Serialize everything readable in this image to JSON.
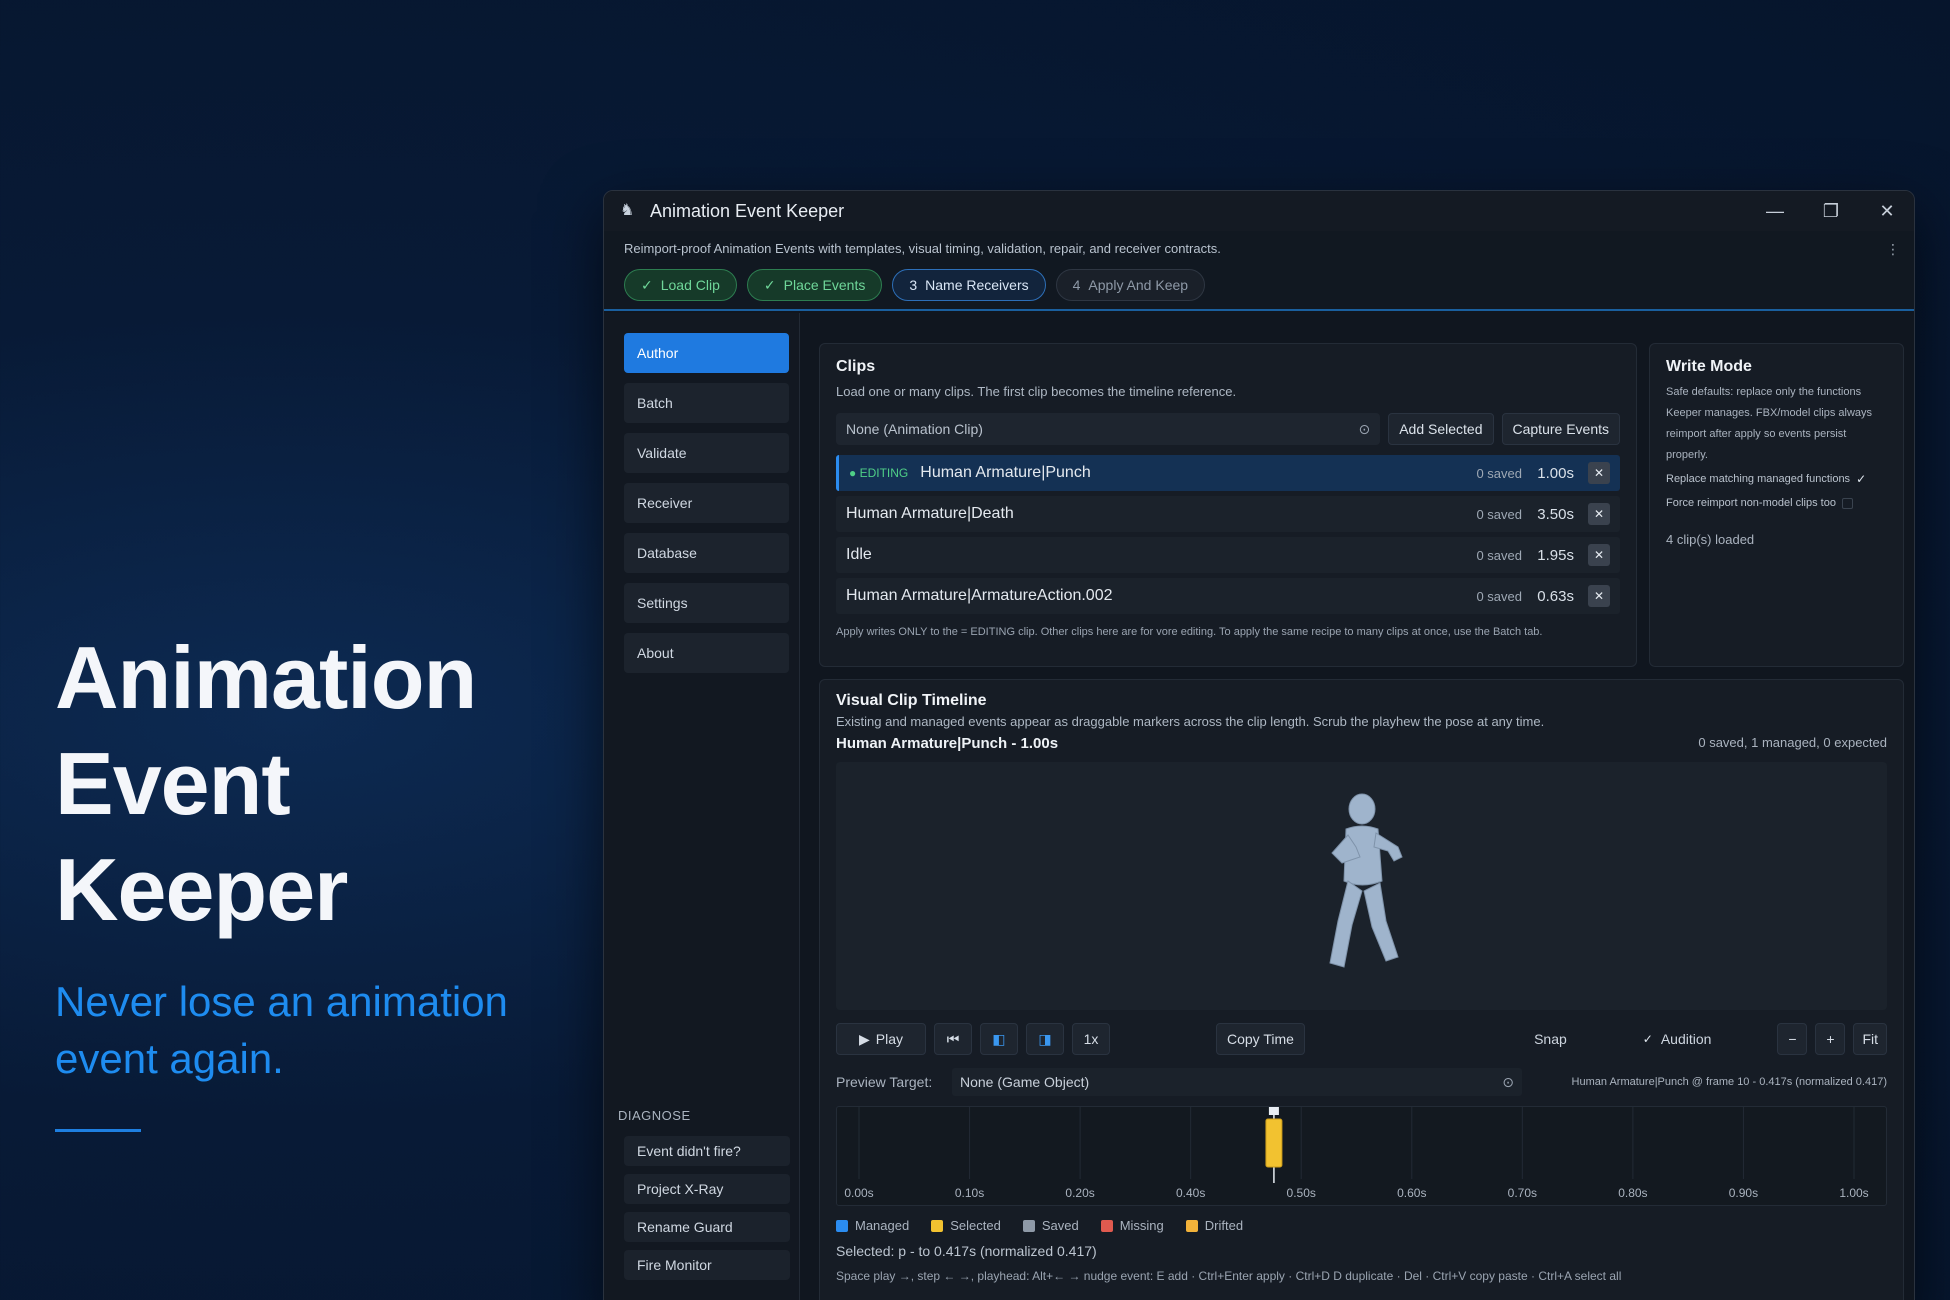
{
  "hero": {
    "title_line1": "Animation",
    "title_line2": "Event Keeper",
    "subtitle_line1": "Never lose an animation",
    "subtitle_line2": "event again."
  },
  "window": {
    "title": "Animation Event Keeper",
    "tagline": "Reimport-proof Animation Events with templates, visual timing, validation, repair, and receiver contracts.",
    "steps": [
      {
        "label": "Load Clip",
        "mark": "✓"
      },
      {
        "label": "Place Events",
        "mark": "✓"
      },
      {
        "label": "Name Receivers",
        "mark": "3"
      },
      {
        "label": "Apply And Keep",
        "mark": "4"
      }
    ]
  },
  "sidebar": {
    "items": [
      "Author",
      "Batch",
      "Validate",
      "Receiver",
      "Database",
      "Settings",
      "About"
    ],
    "diagnose_header": "DIAGNOSE",
    "diagnose": [
      "Event didn't fire?",
      "Project X-Ray",
      "Rename Guard",
      "Fire Monitor"
    ]
  },
  "clips": {
    "title": "Clips",
    "description": "Load one or many clips. The first clip becomes the timeline reference.",
    "select_value": "None (Animation Clip)",
    "add_selected": "Add Selected",
    "capture_events": "Capture Events",
    "editing_badge": "EDITING",
    "rows": [
      {
        "name": "Human Armature|Punch",
        "saved": "0 saved",
        "duration": "1.00s"
      },
      {
        "name": "Human Armature|Death",
        "saved": "0 saved",
        "duration": "3.50s"
      },
      {
        "name": "Idle",
        "saved": "0 saved",
        "duration": "1.95s"
      },
      {
        "name": "Human Armature|ArmatureAction.002",
        "saved": "0 saved",
        "duration": "0.63s"
      }
    ],
    "note": "Apply writes ONLY to the = EDITING clip. Other clips here are for vore editing. To apply the same recipe to many clips at once, use the Batch tab."
  },
  "write_mode": {
    "title": "Write Mode",
    "description": "Safe defaults: replace only the functions Keeper manages. FBX/model clips always reimport after apply so events persist properly.",
    "option1": "Replace matching managed functions",
    "option2": "Force reimport non-model clips too",
    "loaded": "4 clip(s) loaded"
  },
  "timeline": {
    "title": "Visual Clip Timeline",
    "description": "Existing and managed events appear as draggable markers across the clip length. Scrub the playhew the pose at any time.",
    "clip_label": "Human Armature|Punch - 1.00s",
    "counts": "0 saved, 1 managed, 0 expected",
    "play": "Play",
    "speed": "1x",
    "copy_time": "Copy Time",
    "snap": "Snap",
    "audition": "Audition",
    "minus": "−",
    "plus": "+",
    "fit": "Fit",
    "preview_label": "Preview Target:",
    "preview_value": "None (Game Object)",
    "readout": "Human Armature|Punch @ frame 10 - 0.417s (normalized 0.417)",
    "ticks": [
      "0.00s",
      "0.10s",
      "0.20s",
      "0.40s",
      "0.50s",
      "0.60s",
      "0.70s",
      "0.80s",
      "0.90s",
      "1.00s"
    ],
    "playhead": 0.417,
    "legend": [
      "Managed",
      "Selected",
      "Saved",
      "Missing",
      "Drifted"
    ],
    "selected_info": "Selected: p - to 0.417s (normalized 0.417)",
    "shortcuts": "Space play →, step ← →, playhead: Alt+← → nudge event: E add · Ctrl+Enter apply · Ctrl+D D duplicate · Del · Ctrl+V copy paste · Ctrl+A select all"
  },
  "colors": {
    "accent": "#1f7ae0",
    "managed": "#2b8cf0",
    "selected": "#f2c230",
    "saved": "#8e99a7",
    "missing": "#e05a4f",
    "drifted": "#f2b23a"
  }
}
